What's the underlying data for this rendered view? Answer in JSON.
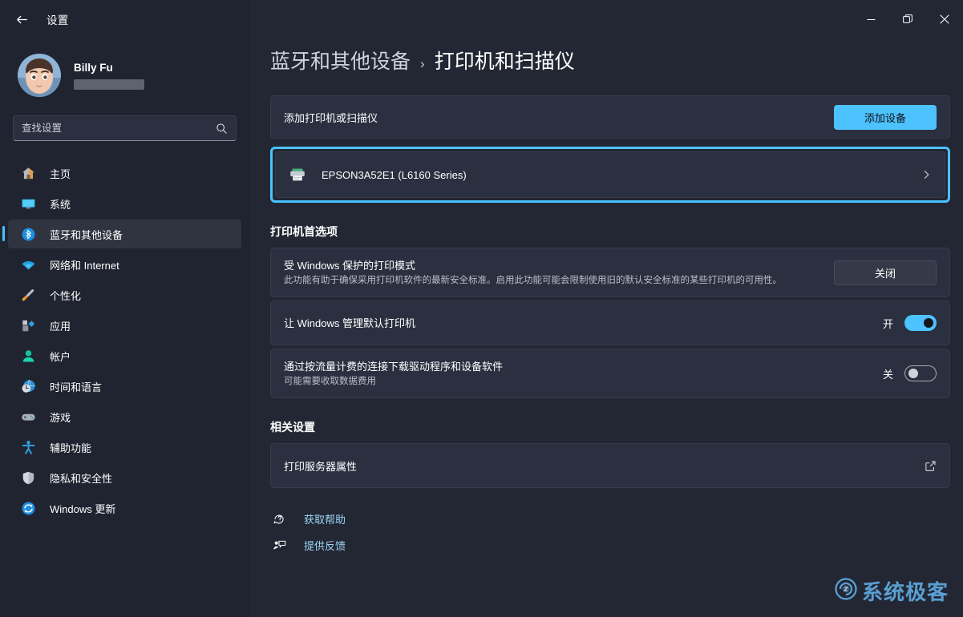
{
  "window": {
    "title": "设置",
    "back_label": "返回",
    "minimize_label": "最小化",
    "maximize_label": "还原",
    "close_label": "关闭"
  },
  "accent_color": "#4cc2ff",
  "sidebar": {
    "profile": {
      "name": "Billy Fu",
      "email_redacted": ""
    },
    "search": {
      "placeholder": "查找设置",
      "value": "",
      "icon": "search-icon"
    },
    "items": [
      {
        "label": "主页",
        "icon": "home-icon",
        "active": false
      },
      {
        "label": "系统",
        "icon": "system-icon",
        "active": false
      },
      {
        "label": "蓝牙和其他设备",
        "icon": "bluetooth-icon",
        "active": true
      },
      {
        "label": "网络和 Internet",
        "icon": "network-icon",
        "active": false
      },
      {
        "label": "个性化",
        "icon": "personalization-icon",
        "active": false
      },
      {
        "label": "应用",
        "icon": "apps-icon",
        "active": false
      },
      {
        "label": "帐户",
        "icon": "accounts-icon",
        "active": false
      },
      {
        "label": "时间和语言",
        "icon": "time-language-icon",
        "active": false
      },
      {
        "label": "游戏",
        "icon": "gaming-icon",
        "active": false
      },
      {
        "label": "辅助功能",
        "icon": "accessibility-icon",
        "active": false
      },
      {
        "label": "隐私和安全性",
        "icon": "privacy-security-icon",
        "active": false
      },
      {
        "label": "Windows 更新",
        "icon": "windows-update-icon",
        "active": false
      }
    ]
  },
  "breadcrumb": {
    "parent": "蓝牙和其他设备",
    "separator": "›",
    "current": "打印机和扫描仪"
  },
  "add_printer": {
    "label": "添加打印机或扫描仪",
    "button": "添加设备"
  },
  "printer": {
    "name": "EPSON3A52E1 (L6160 Series)",
    "icon": "printer-icon",
    "chevron": "chevron-right-icon",
    "highlighted": true
  },
  "preferences": {
    "heading": "打印机首选项",
    "protected_mode": {
      "title": "受 Windows 保护的打印模式",
      "description": "此功能有助于确保采用打印机软件的最新安全标准。启用此功能可能会限制使用旧的默认安全标准的某些打印机的可用性。",
      "button": "关闭"
    },
    "manage_default": {
      "title": "让 Windows 管理默认打印机",
      "state_label": "开",
      "state": "on"
    },
    "metered_download": {
      "title": "通过按流量计费的连接下载驱动程序和设备软件",
      "description": "可能需要收取数据费用",
      "state_label": "关",
      "state": "off"
    }
  },
  "related": {
    "heading": "相关设置",
    "items": [
      {
        "label": "打印服务器属性",
        "icon": "external-link-icon"
      }
    ]
  },
  "footer": {
    "links": [
      {
        "label": "获取帮助",
        "icon": "help-icon"
      },
      {
        "label": "提供反馈",
        "icon": "feedback-icon"
      }
    ]
  },
  "watermark": {
    "text": "系统极客",
    "icon": "spiral-logo-icon"
  }
}
